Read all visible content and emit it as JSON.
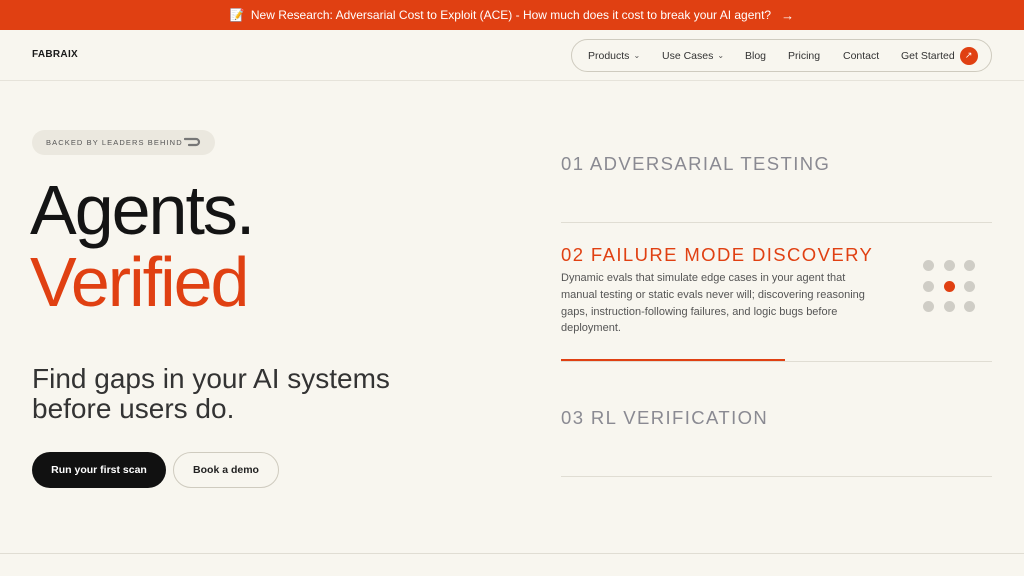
{
  "banner": {
    "icon": "memo-icon",
    "text": "New Research: Adversarial Cost to Exploit (ACE) - How much does it cost to break your AI agent?",
    "arrow": "→",
    "background": "#e04012"
  },
  "nav": {
    "logo": "FABRAIX",
    "items": [
      {
        "label": "Products",
        "dropdown": true
      },
      {
        "label": "Use Cases",
        "dropdown": true
      },
      {
        "label": "Blog"
      },
      {
        "label": "Pricing"
      },
      {
        "label": "Contact"
      }
    ],
    "cta_label": "Get Started",
    "chevron": "⌄",
    "cta_icon": "↗"
  },
  "hero": {
    "backed_label": "BACKED BY LEADERS BEHIND",
    "headline_line1": "Agents.",
    "headline_line2": "Verified",
    "subheadline": "Find gaps in your AI systems before users do.",
    "primary_button": "Run your first scan",
    "secondary_button": "Book a demo"
  },
  "features": [
    {
      "title": "01 ADVERSARIAL TESTING",
      "active": false
    },
    {
      "title": "02 FAILURE MODE DISCOVERY",
      "active": true,
      "description": "Dynamic evals that simulate edge cases in your agent that manual testing or static evals never will; discovering reasoning gaps, instruction-following failures, and logic bugs before deployment."
    },
    {
      "title": "03 RL VERIFICATION",
      "active": false
    }
  ],
  "active_feature_progress": 0.52,
  "dot_grid": {
    "rows": 3,
    "cols": 3,
    "active_index": 4
  },
  "colors": {
    "accent": "#e04012",
    "background": "#f8f6ef",
    "dark": "#111111"
  }
}
